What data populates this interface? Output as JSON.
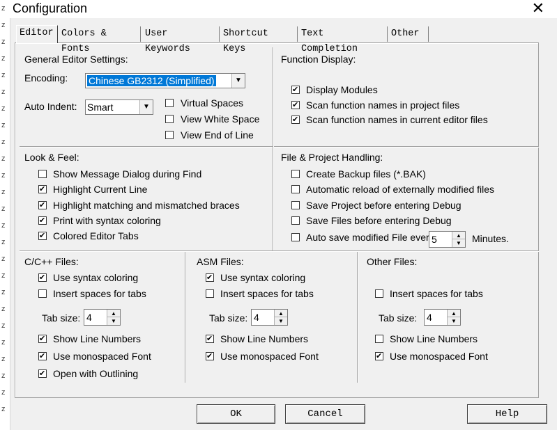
{
  "window": {
    "title": "Configuration",
    "close_glyph": "✕"
  },
  "tabs": [
    {
      "label": "Editor",
      "active": true
    },
    {
      "label": "Colors & Fonts"
    },
    {
      "label": "User Keywords"
    },
    {
      "label": "Shortcut Keys"
    },
    {
      "label": "Text Completion"
    },
    {
      "label": "Other"
    }
  ],
  "general": {
    "heading": "General Editor Settings:",
    "encoding_label": "Encoding:",
    "encoding_value": "Chinese GB2312 (Simplified)",
    "autoindent_label": "Auto Indent:",
    "autoindent_value": "Smart",
    "virtual_spaces": {
      "label": "Virtual Spaces",
      "checked": false
    },
    "view_white_space": {
      "label": "View White Space",
      "checked": false
    },
    "view_end_of_line": {
      "label": "View End of Line",
      "checked": false
    }
  },
  "function_display": {
    "heading": "Function Display:",
    "items": [
      {
        "label": "Display Modules",
        "checked": true
      },
      {
        "label": "Scan function names in project files",
        "checked": true
      },
      {
        "label": "Scan function names in current editor files",
        "checked": true
      }
    ]
  },
  "look_feel": {
    "heading": "Look & Feel:",
    "items": [
      {
        "label": "Show Message Dialog during Find",
        "checked": false
      },
      {
        "label": "Highlight Current Line",
        "checked": true
      },
      {
        "label": "Highlight matching and mismatched braces",
        "checked": true
      },
      {
        "label": "Print with syntax coloring",
        "checked": true
      },
      {
        "label": "Colored Editor Tabs",
        "checked": true
      }
    ]
  },
  "file_project": {
    "heading": "File & Project Handling:",
    "items": [
      {
        "label": "Create Backup files (*.BAK)",
        "checked": false
      },
      {
        "label": "Automatic reload of externally modified files",
        "checked": false
      },
      {
        "label": "Save Project before entering Debug",
        "checked": false
      },
      {
        "label": "Save Files before entering Debug",
        "checked": false
      },
      {
        "label": "Auto save modified File every",
        "checked": false
      }
    ],
    "autosave_minutes": "5",
    "minutes_label": "Minutes."
  },
  "c_files": {
    "heading": "C/C++ Files:",
    "syntax": {
      "label": "Use syntax coloring",
      "checked": true
    },
    "spaces": {
      "label": "Insert spaces for tabs",
      "checked": false
    },
    "tab_label": "Tab size:",
    "tab_size": "4",
    "line_numbers": {
      "label": "Show Line Numbers",
      "checked": true
    },
    "mono": {
      "label": "Use monospaced Font",
      "checked": true
    },
    "outlining": {
      "label": "Open with Outlining",
      "checked": true
    }
  },
  "asm_files": {
    "heading": "ASM Files:",
    "syntax": {
      "label": "Use syntax coloring",
      "checked": true
    },
    "spaces": {
      "label": "Insert spaces for tabs",
      "checked": false
    },
    "tab_label": "Tab size:",
    "tab_size": "4",
    "line_numbers": {
      "label": "Show Line Numbers",
      "checked": true
    },
    "mono": {
      "label": "Use monospaced Font",
      "checked": true
    }
  },
  "other_files": {
    "heading": "Other Files:",
    "spaces": {
      "label": "Insert spaces for tabs",
      "checked": false
    },
    "tab_label": "Tab size:",
    "tab_size": "4",
    "line_numbers": {
      "label": "Show Line Numbers",
      "checked": false
    },
    "mono": {
      "label": "Use monospaced Font",
      "checked": true
    }
  },
  "buttons": {
    "ok": "OK",
    "cancel": "Cancel",
    "help": "Help"
  },
  "colors": {
    "selection": "#0078d7",
    "background": "#f0f0f0"
  }
}
